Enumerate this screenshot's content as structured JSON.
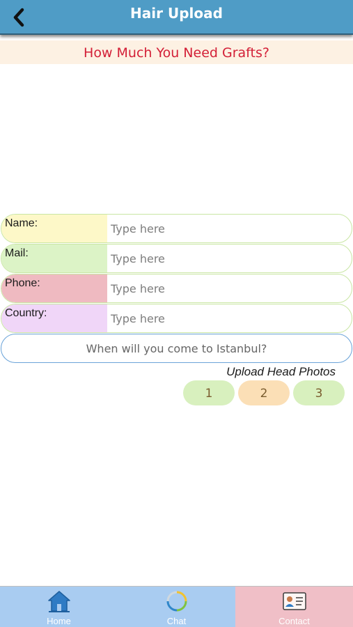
{
  "header": {
    "title": "Hair Upload",
    "back_icon": "chevron-left-icon"
  },
  "subtitle": "How Much You Need Grafts?",
  "form": {
    "fields": [
      {
        "label": "Name:",
        "placeholder": "Type here",
        "label_color": "#fdf8c8"
      },
      {
        "label": "Mail:",
        "placeholder": "Type here",
        "label_color": "#dcf3c6"
      },
      {
        "label": "Phone:",
        "placeholder": "Type here",
        "label_color": "#efbac1"
      },
      {
        "label": "Country:",
        "placeholder": "Type here",
        "label_color": "#f0d6f8"
      }
    ],
    "come_question": "When will you come to Istanbul?"
  },
  "upload": {
    "label": "Upload Head Photos",
    "buttons": [
      {
        "label": "1",
        "color": "#d8f0be"
      },
      {
        "label": "2",
        "color": "#fbdfb6"
      },
      {
        "label": "3",
        "color": "#d8f0be"
      }
    ]
  },
  "tabbar": {
    "tabs": [
      {
        "label": "Home",
        "icon": "home-icon",
        "bg": "#a9ccf1",
        "label_color": "#ffffff"
      },
      {
        "label": "Chat",
        "icon": "chat-icon",
        "bg": "#a9ccf1",
        "label_color": "#ffffff"
      },
      {
        "label": "Contact",
        "icon": "contact-card-icon",
        "bg": "#f0bfc7",
        "label_color": "#ffffff"
      }
    ]
  },
  "colors": {
    "header": "#4f9cc6",
    "subtitle_text": "#d31f37",
    "subtitle_bg": "#fdf1e3"
  }
}
